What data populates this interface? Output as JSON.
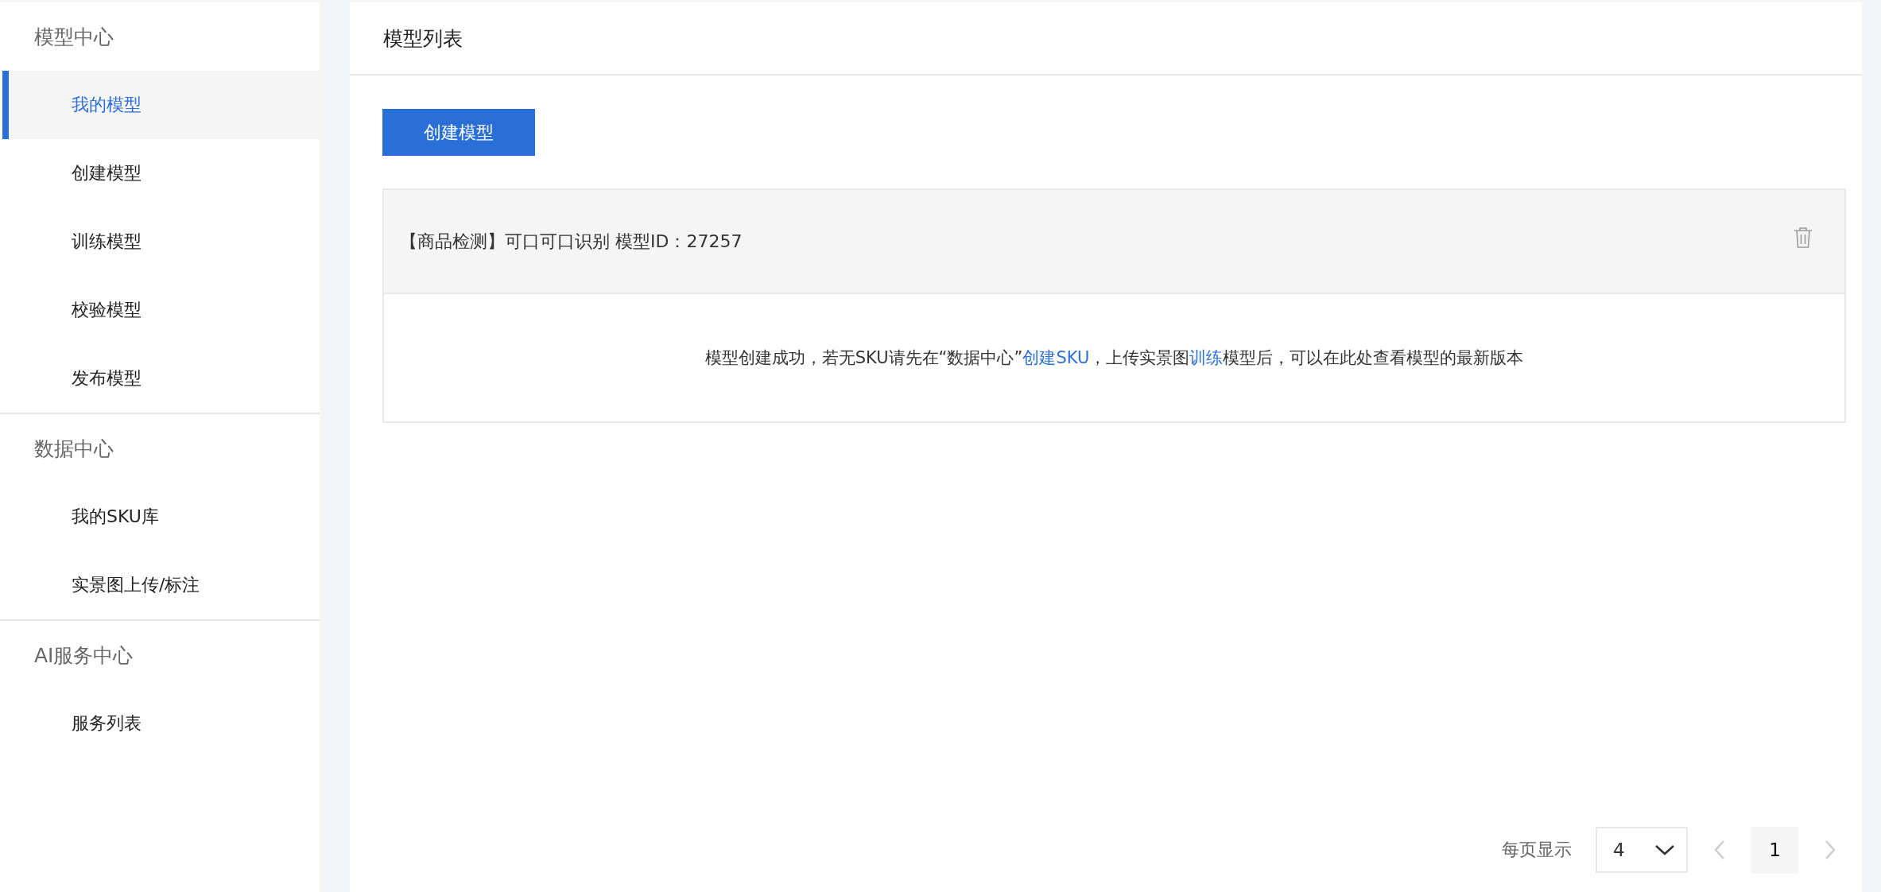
{
  "sidebar": {
    "groups": [
      {
        "title": "模型中心",
        "items": [
          {
            "label": "我的模型",
            "selected": true
          },
          {
            "label": "创建模型",
            "selected": false
          },
          {
            "label": "训练模型",
            "selected": false
          },
          {
            "label": "校验模型",
            "selected": false
          },
          {
            "label": "发布模型",
            "selected": false
          }
        ]
      },
      {
        "title": "数据中心",
        "items": [
          {
            "label": "我的SKU库",
            "selected": false
          },
          {
            "label": "实景图上传/标注",
            "selected": false
          }
        ]
      },
      {
        "title": "AI服务中心",
        "items": [
          {
            "label": "服务列表",
            "selected": false
          }
        ]
      }
    ]
  },
  "main": {
    "title": "模型列表",
    "create_button": "创建模型",
    "model_card": {
      "title": "【商品检测】可口可口识别 模型ID：27257",
      "message": [
        {
          "kind": "text",
          "text": "模型创建成功，若无SKU请先在“数据中心”"
        },
        {
          "kind": "link",
          "text": "创建SKU"
        },
        {
          "kind": "text",
          "text": "，上传实景图"
        },
        {
          "kind": "link",
          "text": "训练"
        },
        {
          "kind": "text",
          "text": "模型后，可以在此处查看模型的最新版本"
        }
      ]
    },
    "pagination": {
      "per_page_label": "每页显示",
      "per_page_value": "4",
      "prev_disabled": true,
      "pages": [
        {
          "label": "1",
          "selected": true
        }
      ],
      "next_disabled": true
    }
  }
}
